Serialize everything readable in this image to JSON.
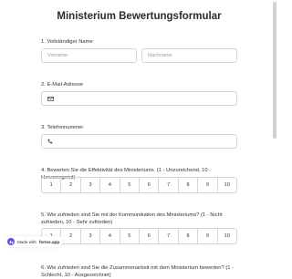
{
  "form": {
    "title": "Ministerium Bewertungsformular",
    "q1": {
      "label": "1. Vollständiger Name",
      "first_placeholder": "Vorname",
      "last_placeholder": "Nachname"
    },
    "q2": {
      "label": "2. E-Mail-Adresse",
      "icon": "mail-icon"
    },
    "q3": {
      "label": "3. Telefonnummer",
      "icon": "phone-icon"
    },
    "q4": {
      "label": "4. Bewerten Sie die Effektivität des Ministeriums. (1 - Unzureichend, 10 - Hervorragend)",
      "scale": [
        "1",
        "2",
        "3",
        "4",
        "5",
        "6",
        "7",
        "8",
        "9",
        "10"
      ]
    },
    "q5": {
      "label": "5. Wie zufrieden sind Sie mit der Kommunikation des Ministeriums? (1 - Nicht zufrieden, 10 - Sehr zufrieden)",
      "scale": [
        "1",
        "2",
        "3",
        "4",
        "5",
        "6",
        "7",
        "8",
        "9",
        "10"
      ]
    },
    "q6": {
      "label": "6. Wie zufrieden sind Sie die Zusammenarbeit mit dem Ministerium bewerten? (1 - Schlecht, 10 - Ausgezeichnet)"
    }
  },
  "badge": {
    "prefix": "Made with",
    "brand": "forms.app"
  },
  "colors": {
    "accent": "#6b4fd8",
    "border": "#d6d6dc"
  }
}
